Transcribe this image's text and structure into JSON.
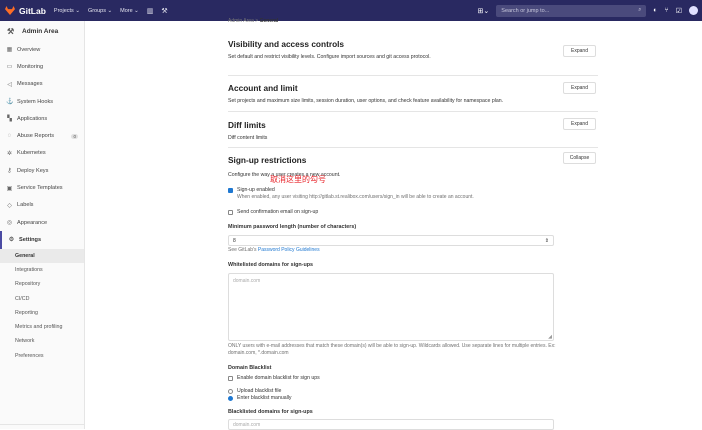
{
  "topbar": {
    "brand": "GitLab",
    "nav": [
      "Projects ⌄",
      "Groups ⌄",
      "More ⌄"
    ],
    "search_placeholder": "Search or jump to...",
    "icons": [
      "chart-icon",
      "wrench-icon",
      "plus-icon",
      "search-icon",
      "issues-icon",
      "merge-request-icon",
      "todo-icon",
      "help-icon"
    ]
  },
  "sidebar": {
    "header": "Admin Area",
    "items": [
      {
        "label": "Overview",
        "icon": "grid-icon"
      },
      {
        "label": "Monitoring",
        "icon": "monitor-icon"
      },
      {
        "label": "Messages",
        "icon": "megaphone-icon"
      },
      {
        "label": "System Hooks",
        "icon": "hook-icon"
      },
      {
        "label": "Applications",
        "icon": "apps-icon"
      },
      {
        "label": "Abuse Reports",
        "icon": "abuse-icon",
        "badge": "0"
      },
      {
        "label": "Kubernetes",
        "icon": "kubernetes-icon"
      },
      {
        "label": "Deploy Keys",
        "icon": "key-icon"
      },
      {
        "label": "Service Templates",
        "icon": "template-icon"
      },
      {
        "label": "Labels",
        "icon": "label-icon"
      },
      {
        "label": "Appearance",
        "icon": "appearance-icon"
      },
      {
        "label": "Settings",
        "icon": "settings-icon"
      }
    ],
    "subitems": [
      "General",
      "Integrations",
      "Repository",
      "CI/CD",
      "Reporting",
      "Metrics and profiling",
      "Network",
      "Preferences"
    ]
  },
  "breadcrumb": {
    "parent": "Admin Area",
    "current": "General"
  },
  "sections": {
    "visibility": {
      "title": "Visibility and access controls",
      "desc": "Set default and restrict visibility levels. Configure import sources and git access protocol.",
      "button": "Expand"
    },
    "account": {
      "title": "Account and limit",
      "desc": "Set projects and maximum size limits, session duration, user options, and check feature availability for namespace plan.",
      "button": "Expand"
    },
    "diff": {
      "title": "Diff limits",
      "desc": "Diff content limits",
      "button": "Expand"
    },
    "signup": {
      "title": "Sign-up restrictions",
      "desc": "Configure the way a user creates a new account.",
      "button": "Collapse",
      "signup_enabled_label": "Sign-up enabled",
      "signup_enabled_help": "When enabled, any user visiting http://gitlab.st.realibox.com/users/sign_in will be able to create an account.",
      "annotation": "取消这里的勾号",
      "confirm_email_label": "Send confirmation email on sign-up",
      "min_pw_label": "Minimum password length (number of characters)",
      "min_pw_value": "8",
      "pw_policy_prefix": "See GitLab's",
      "pw_policy_link": "Password Policy Guidelines",
      "whitelist_label": "Whitelisted domains for sign-ups",
      "whitelist_placeholder": "domain.com",
      "whitelist_help": "ONLY users with e-mail addresses that match these domain(s) will be able to sign-up. Wildcards allowed. Use separate lines for multiple entries. Ex: domain.com, *.domain.com",
      "blacklist_heading": "Domain Blacklist",
      "blacklist_enable_label": "Enable domain blacklist for sign ups",
      "upload_label": "Upload blacklist file",
      "manual_label": "Enter blacklist manually",
      "blacklisted_label": "Blacklisted domains for sign-ups",
      "blacklisted_placeholder": "domain.com"
    }
  },
  "colors": {
    "topbar": "#292961",
    "accent": "#1f78d1",
    "annotation": "#e8242a"
  }
}
